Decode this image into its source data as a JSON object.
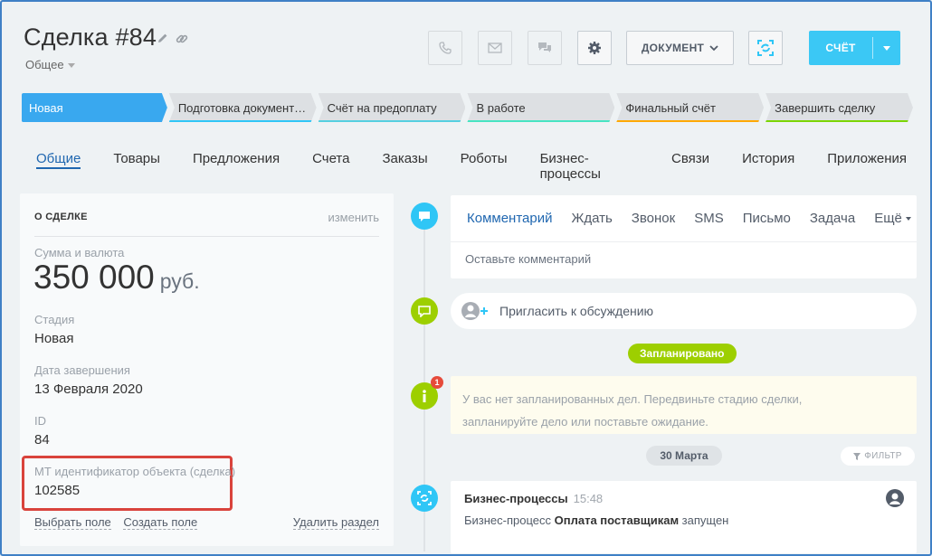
{
  "deal": {
    "title": "Сделка #84",
    "category": "Общее"
  },
  "toolbar": {
    "document_label": "ДОКУМЕНТ",
    "invoice_label": "СЧЁТ"
  },
  "stages": [
    {
      "label": "Новая",
      "color": "#39a8ef",
      "active": true
    },
    {
      "label": "Подготовка документ…",
      "color": "#2fc6f6"
    },
    {
      "label": "Счёт на предоплату",
      "color": "#55d0e0"
    },
    {
      "label": "В работе",
      "color": "#47e4c2"
    },
    {
      "label": "Финальный счёт",
      "color": "#ffa900"
    },
    {
      "label": "Завершить сделку",
      "color": "#7bd500"
    }
  ],
  "tabs": [
    "Общие",
    "Товары",
    "Предложения",
    "Счета",
    "Заказы",
    "Роботы",
    "Бизнес-процессы",
    "Связи",
    "История",
    "Приложения"
  ],
  "about": {
    "heading": "О СДЕЛКЕ",
    "edit": "изменить",
    "amount_label": "Сумма и валюта",
    "amount": "350 000",
    "currency": "руб.",
    "stage_label": "Стадия",
    "stage": "Новая",
    "close_date_label": "Дата завершения",
    "close_date": "13 Февраля 2020",
    "id_label": "ID",
    "id": "84",
    "mt_label": "МТ идентификатор объекта (сделка)",
    "mt_value": "102585",
    "select_field": "Выбрать поле",
    "create_field": "Создать поле",
    "delete_section": "Удалить раздел"
  },
  "composer": {
    "tabs": [
      "Комментарий",
      "Ждать",
      "Звонок",
      "SMS",
      "Письмо",
      "Задача",
      "Ещё"
    ],
    "placeholder": "Оставьте комментарий"
  },
  "timeline": {
    "invite": "Пригласить к обсуждению",
    "planned": "Запланировано",
    "badge_count": "1",
    "empty_line1": "У вас нет запланированных дел. Передвиньте стадию сделки,",
    "empty_line2": "запланируйте дело или поставьте ожидание.",
    "date_pill": "30 Марта",
    "filter": "ФИЛЬТР",
    "event_title": "Бизнес-процессы",
    "event_time": "15:48",
    "event_prefix": "Бизнес-процесс ",
    "event_name": "Оплата поставщикам",
    "event_suffix": " запущен"
  },
  "colors": {
    "accent": "#2067b0",
    "primary_button": "#3bc8f5",
    "timeline_blue": "#2fc6f6",
    "timeline_green": "#9dcf00",
    "highlight_border": "#d9433c"
  }
}
